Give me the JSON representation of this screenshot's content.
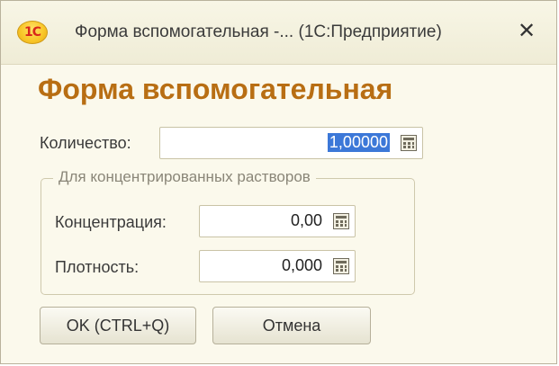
{
  "window": {
    "title": "Форма вспомогательная -... (1С:Предприятие)",
    "logo_text": "1С"
  },
  "form": {
    "heading": "Форма вспомогательная",
    "quantity": {
      "label": "Количество:",
      "value": "1,00000"
    },
    "group": {
      "title": "Для концентрированных растворов",
      "concentration": {
        "label": "Концентрация:",
        "value": "0,00"
      },
      "density": {
        "label": "Плотность:",
        "value": "0,000"
      }
    }
  },
  "buttons": {
    "ok": "OK (CTRL+Q)",
    "cancel": "Отмена"
  },
  "colors": {
    "heading": "#b86e13",
    "window_bg": "#fbf9ec",
    "selection": "#3c78d8"
  },
  "icons": [
    "app-logo-icon",
    "close-icon",
    "calculator-icon"
  ]
}
